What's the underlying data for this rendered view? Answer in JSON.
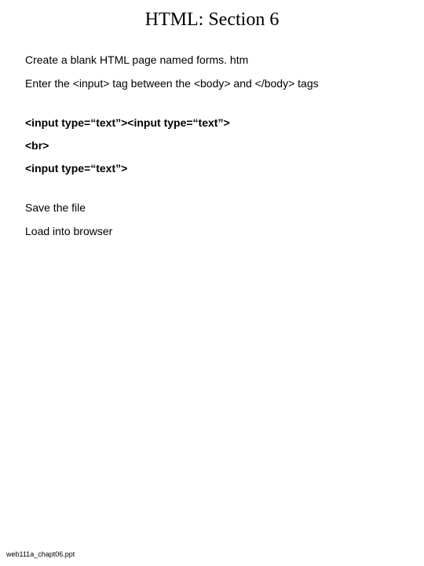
{
  "title": "HTML: Section 6",
  "intro": {
    "line1": "Create a blank HTML page named forms. htm",
    "line2": "Enter the <input> tag between the <body> and </body> tags"
  },
  "code": {
    "line1": "<input type=“text”><input type=“text”>",
    "line2": "<br>",
    "line3": "<input type=“text”>"
  },
  "outro": {
    "line1": "Save the file",
    "line2": "Load into browser"
  },
  "footer": "web111a_chapt06.ppt"
}
